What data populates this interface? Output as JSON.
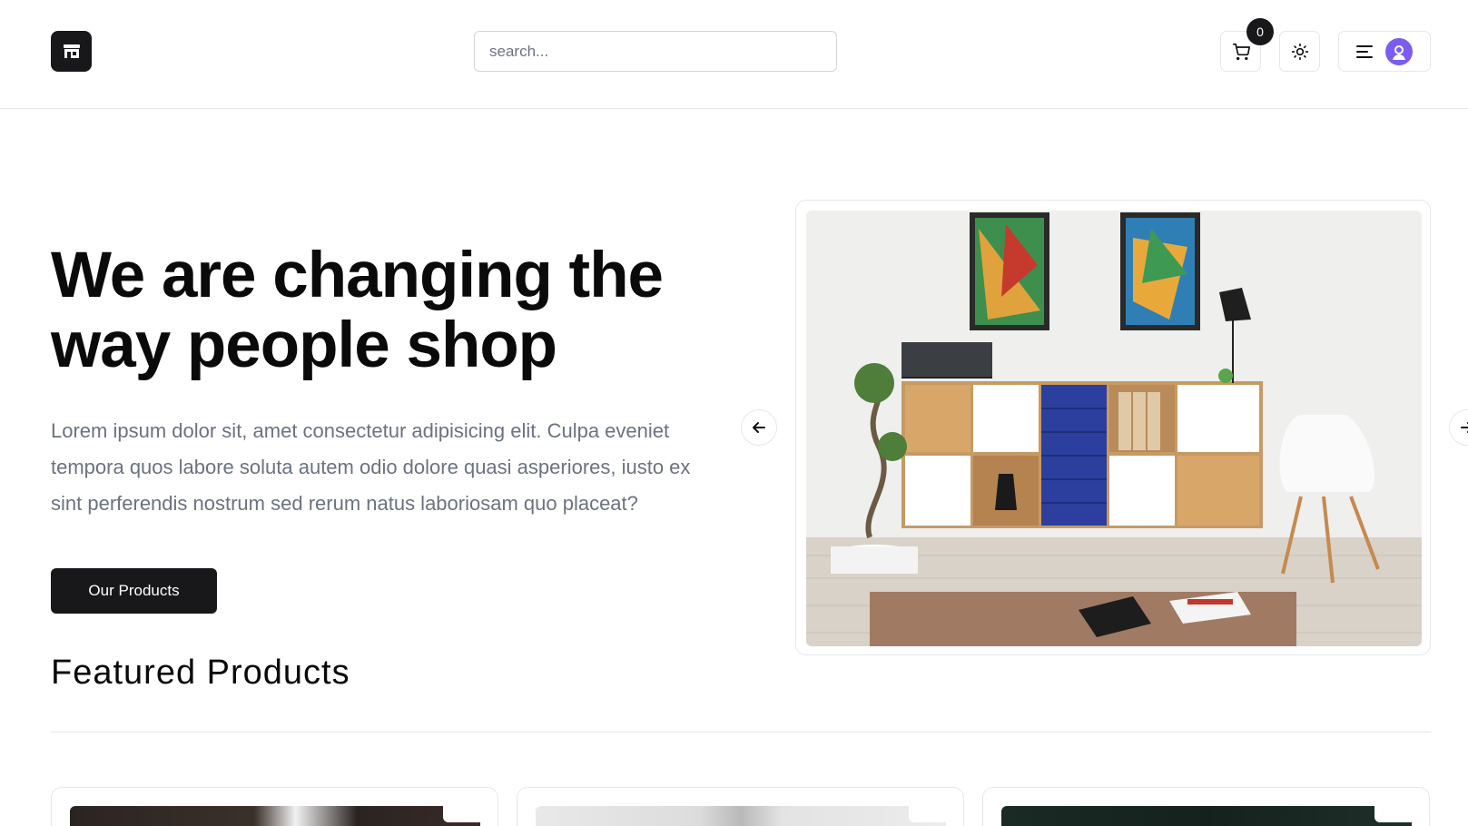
{
  "header": {
    "logo_icon": "store-icon",
    "search_placeholder": "search...",
    "cart_count": "0",
    "cart_icon": "cart-icon",
    "theme_icon": "sun-icon",
    "menu_icon": "menu-lines-icon",
    "avatar_icon": "user-avatar-icon",
    "avatar_color": "#7c5cf0"
  },
  "hero": {
    "title": "We are changing the way people shop",
    "description": "Lorem ipsum dolor sit, amet consectetur adipisicing elit. Culpa eveniet tempora quos labore soluta autem odio dolore quasi asperiores, iusto ex sint perferendis nostrum sed rerum natus laboriosam quo placeat?",
    "cta_label": "Our Products",
    "carousel_prev_icon": "arrow-left-icon",
    "carousel_next_icon": "arrow-right-icon"
  },
  "featured": {
    "title": "Featured Products"
  },
  "colors": {
    "primary": "#18181b",
    "muted_text": "#6b7280",
    "border": "#e5e7eb"
  }
}
